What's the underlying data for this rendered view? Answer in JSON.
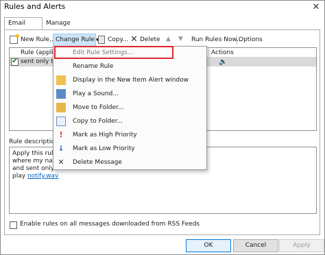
{
  "window": {
    "title": "Rules and Alerts",
    "close_glyph": "✕"
  },
  "tabs": [
    {
      "label": "Email Rules",
      "active": true
    },
    {
      "label": "Manage Alerts",
      "active": false
    }
  ],
  "toolbar": {
    "new_rule": "New Rule...",
    "change_rule": "Change Rule",
    "copy": "Copy...",
    "delete": "Delete",
    "run_rules": "Run Rules Now...",
    "options": "Options"
  },
  "rules_table": {
    "headers": {
      "rule": "Rule (applie",
      "actions": "Actions"
    },
    "rows": [
      {
        "enabled": true,
        "name": "sent only to",
        "action_icon": "speaker-icon"
      }
    ]
  },
  "change_rule_menu": {
    "items": [
      {
        "label": "Edit Rule Settings...",
        "icon": ""
      },
      {
        "label": "Rename Rule",
        "icon": ""
      },
      {
        "label": "Display in the New Item Alert window",
        "icon": "alert-window-icon"
      },
      {
        "label": "Play a Sound...",
        "icon": "sound-icon"
      },
      {
        "label": "Move to Folder...",
        "icon": "folder-icon"
      },
      {
        "label": "Copy to Folder...",
        "icon": "copy-folder-icon"
      },
      {
        "label": "Mark as High Priority",
        "icon": "high-priority-icon"
      },
      {
        "label": "Mark as Low Priority",
        "icon": "low-priority-icon"
      },
      {
        "label": "Delete Message",
        "icon": "delete-x-icon"
      }
    ]
  },
  "description": {
    "label": "Rule description",
    "lines": [
      "Apply this rule a",
      "where my name",
      "and sent only to me",
      "play"
    ],
    "link": "notify.wav"
  },
  "rss_checkbox": {
    "label": "Enable rules on all messages downloaded from RSS Feeds",
    "checked": false
  },
  "buttons": {
    "ok": "OK",
    "cancel": "Cancel",
    "apply": "Apply"
  },
  "colors": {
    "highlight_border": "#e0262c",
    "selected_button": "#cce4f7",
    "link": "#0563c1"
  }
}
